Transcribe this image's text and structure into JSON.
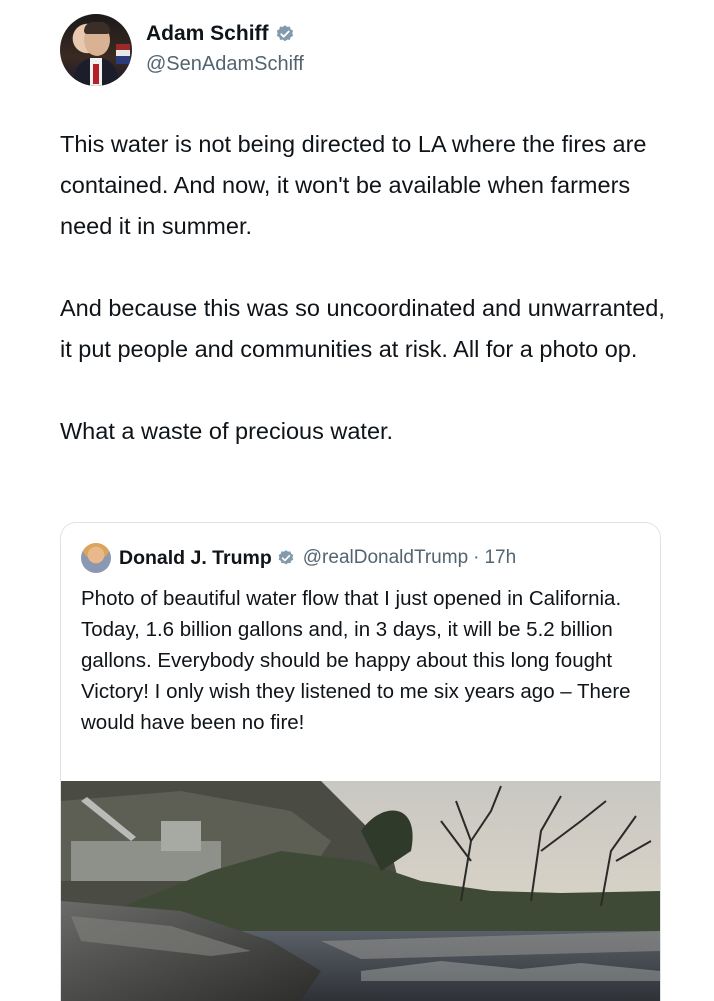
{
  "tweet": {
    "author_name": "Adam Schiff",
    "author_handle": "@SenAdamSchiff",
    "verified_icon": "verified-badge-icon",
    "paragraphs": [
      "This water is not being directed to LA where the fires are contained. And now, it won't be available when farmers need it in summer.",
      "And because this was so uncoordinated and unwarranted, it put people and communities at risk. All for a photo op.",
      "What a waste of precious water."
    ]
  },
  "quoted_tweet": {
    "author_name": "Donald J. Trump",
    "author_handle": "@realDonaldTrump",
    "separator": "·",
    "time": "17h",
    "verified_icon": "verified-badge-icon",
    "text": "Photo of beautiful water flow that I just opened in California. Today, 1.6 billion gallons and, in 3 days, it will be 5.2 billion gallons. Everybody should be happy about this long fought Victory! I only wish they listened to me six years ago – There would have been no fire!"
  },
  "colors": {
    "text_primary": "#0f1419",
    "text_secondary": "#536471",
    "badge": "#829aab",
    "border": "#dfe3e6"
  }
}
